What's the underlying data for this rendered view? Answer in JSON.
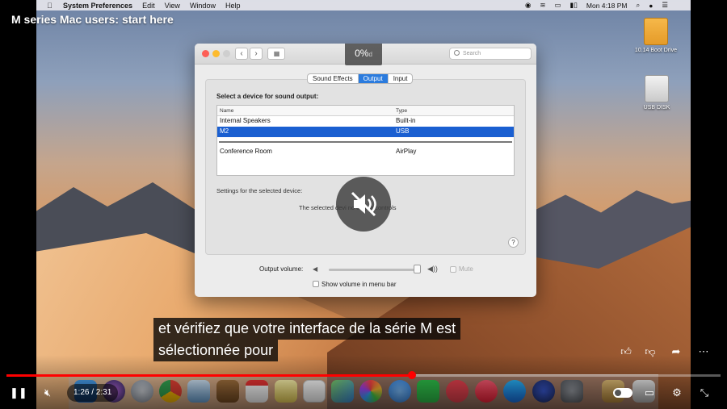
{
  "menubar": {
    "app": "System Preferences",
    "items": [
      "Edit",
      "View",
      "Window",
      "Help"
    ],
    "clock": "Mon 4:18 PM"
  },
  "video": {
    "title": "M series Mac users: start here"
  },
  "desktop": {
    "icons": [
      {
        "label": "10.14 Boot Drive"
      },
      {
        "label": "USB DISK"
      }
    ]
  },
  "window": {
    "title_partial": "d",
    "search_placeholder": "Search",
    "overlay_percent": "0%",
    "tabs": [
      {
        "label": "Sound Effects",
        "active": false
      },
      {
        "label": "Output",
        "active": true
      },
      {
        "label": "Input",
        "active": false
      }
    ],
    "select_heading": "Select a device for sound output:",
    "columns": [
      "Name",
      "Type"
    ],
    "devices": [
      {
        "name": "Internal Speakers",
        "type": "Built-in",
        "selected": false
      },
      {
        "name": "M2",
        "type": "USB",
        "selected": true
      },
      {
        "name": "Conference Room",
        "type": "AirPlay",
        "selected": false
      }
    ],
    "settings_label": "Settings for the selected device:",
    "no_controls_text": "The selected devi  no output controls",
    "help": "?",
    "output_volume_label": "Output volume:",
    "output_volume_level": 0.95,
    "mute_label": "Mute",
    "show_volume_label": "Show volume in menu bar"
  },
  "caption": {
    "line1": "et vérifiez que votre interface de la série M est",
    "line2": "sélectionnée pour"
  },
  "player": {
    "time": "1:26 / 2:31",
    "progress": 0.568,
    "accent": "#ff0000"
  }
}
